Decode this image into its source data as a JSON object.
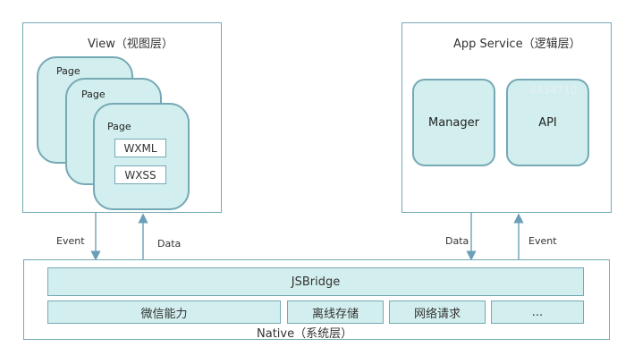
{
  "view_layer": {
    "title": "View（视图层）",
    "pages": [
      {
        "label": "Page"
      },
      {
        "label": "Page"
      },
      {
        "label": "Page"
      }
    ],
    "files": [
      "WXML",
      "WXSS"
    ]
  },
  "app_service_layer": {
    "title": "App Service（逻辑层）",
    "modules": [
      {
        "label": "Manager"
      },
      {
        "label": "API"
      }
    ],
    "watermark": "4434710"
  },
  "flows": {
    "view_to_native": "Event",
    "native_to_view": "Data",
    "native_to_service": "Data",
    "service_to_native": "Event"
  },
  "native_layer": {
    "title": "Native（系统层）",
    "bridge": "JSBridge",
    "capabilities": [
      "微信能力",
      "离线存储",
      "网络请求",
      "..."
    ]
  },
  "colors": {
    "fill": "#d3eeee",
    "border": "#74a9b5",
    "arrow": "#6b9fb8"
  }
}
